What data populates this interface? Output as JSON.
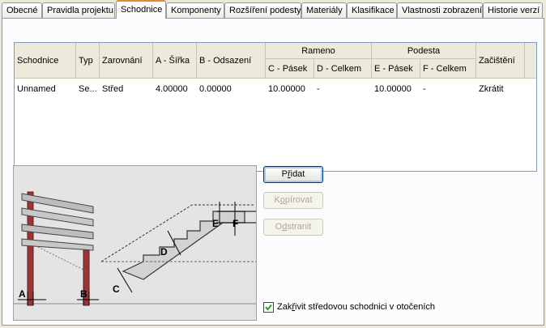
{
  "tabs": [
    {
      "label": "Obecné",
      "active": false
    },
    {
      "label": "Pravidla projektu",
      "active": false
    },
    {
      "label": "Schodnice",
      "active": true
    },
    {
      "label": "Komponenty",
      "active": false
    },
    {
      "label": "Rozšíření podesty",
      "active": false
    },
    {
      "label": "Materiály",
      "active": false
    },
    {
      "label": "Klasifikace",
      "active": false
    },
    {
      "label": "Vlastnosti zobrazení",
      "active": false
    },
    {
      "label": "Historie verzí",
      "active": false
    }
  ],
  "table": {
    "headers": {
      "schodnice": "Schodnice",
      "typ": "Typ",
      "zarovnani": "Zarovnání",
      "a_sirka": "A - Šířka",
      "b_odsazeni": "B - Odsazení",
      "rameno": "Rameno",
      "c_pasek": "C - Pásek",
      "d_celkem": "D - Celkem",
      "podesta": "Podesta",
      "e_pasek": "E - Pásek",
      "f_celkem": "F - Celkem",
      "zacisteni": "Začištění"
    },
    "rows": [
      {
        "schodnice": "Unnamed",
        "typ": "Se...",
        "zarovnani": "Střed",
        "a_sirka": "4.00000",
        "b_odsazeni": "0.00000",
        "c_pasek": "10.00000",
        "d_celkem": "-",
        "e_pasek": "10.00000",
        "f_celkem": "-",
        "zacisteni": "Zkrátit"
      }
    ]
  },
  "diagram": {
    "labels": {
      "a": "A",
      "b": "B",
      "c": "C",
      "d": "D",
      "e": "E",
      "f": "F"
    }
  },
  "buttons": {
    "add": {
      "pre": "P",
      "ul": "ř",
      "post": "idat"
    },
    "copy": {
      "pre": "K",
      "ul": "o",
      "post": "pírovat"
    },
    "remove": {
      "pre": "O",
      "ul": "d",
      "post": "stranit"
    }
  },
  "checkbox": {
    "checked": true,
    "label_pre": "Zak",
    "label_ul": "ř",
    "label_post": "ivit středovou schodnici v otočeních"
  }
}
